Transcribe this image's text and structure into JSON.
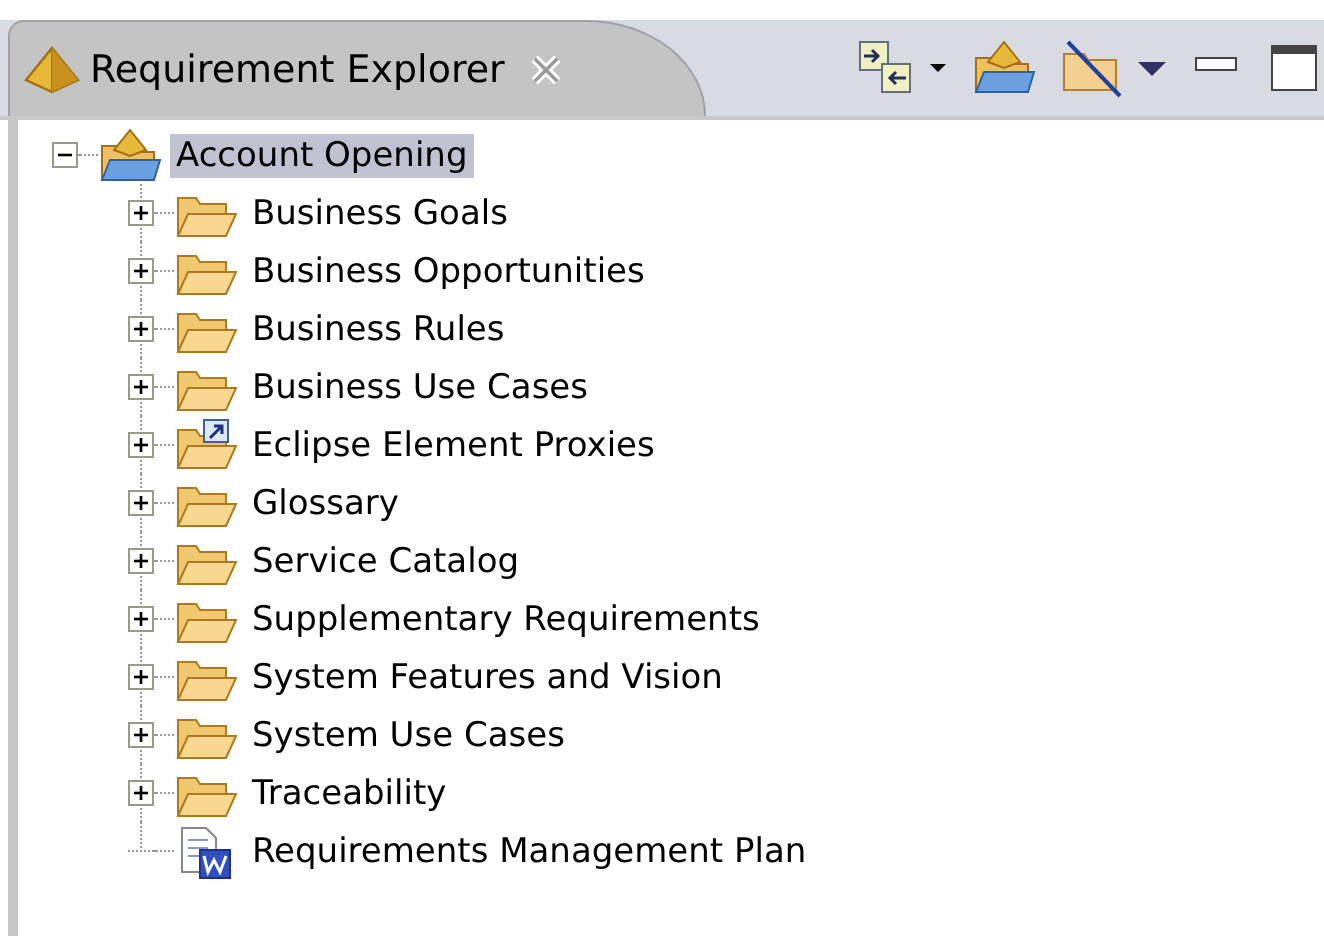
{
  "view_tab": {
    "title": "Requirement Explorer",
    "selected": true
  },
  "tree": {
    "label": "Account Opening",
    "kind": "project",
    "selected": true,
    "expanded": true,
    "children": [
      {
        "label": "Business Goals",
        "kind": "folder",
        "expanded": false
      },
      {
        "label": "Business Opportunities",
        "kind": "folder",
        "expanded": false
      },
      {
        "label": "Business Rules",
        "kind": "folder",
        "expanded": false
      },
      {
        "label": "Business Use Cases",
        "kind": "folder",
        "expanded": false
      },
      {
        "label": "Eclipse Element Proxies",
        "kind": "proxy",
        "expanded": false
      },
      {
        "label": "Glossary",
        "kind": "folder",
        "expanded": false
      },
      {
        "label": "Service Catalog",
        "kind": "folder",
        "expanded": false
      },
      {
        "label": "Supplementary Requirements",
        "kind": "folder",
        "expanded": false
      },
      {
        "label": "System Features and Vision",
        "kind": "folder",
        "expanded": false
      },
      {
        "label": "System Use Cases",
        "kind": "folder",
        "expanded": false
      },
      {
        "label": "Traceability",
        "kind": "folder",
        "expanded": false
      },
      {
        "label": "Requirements Management Plan",
        "kind": "document"
      }
    ]
  }
}
